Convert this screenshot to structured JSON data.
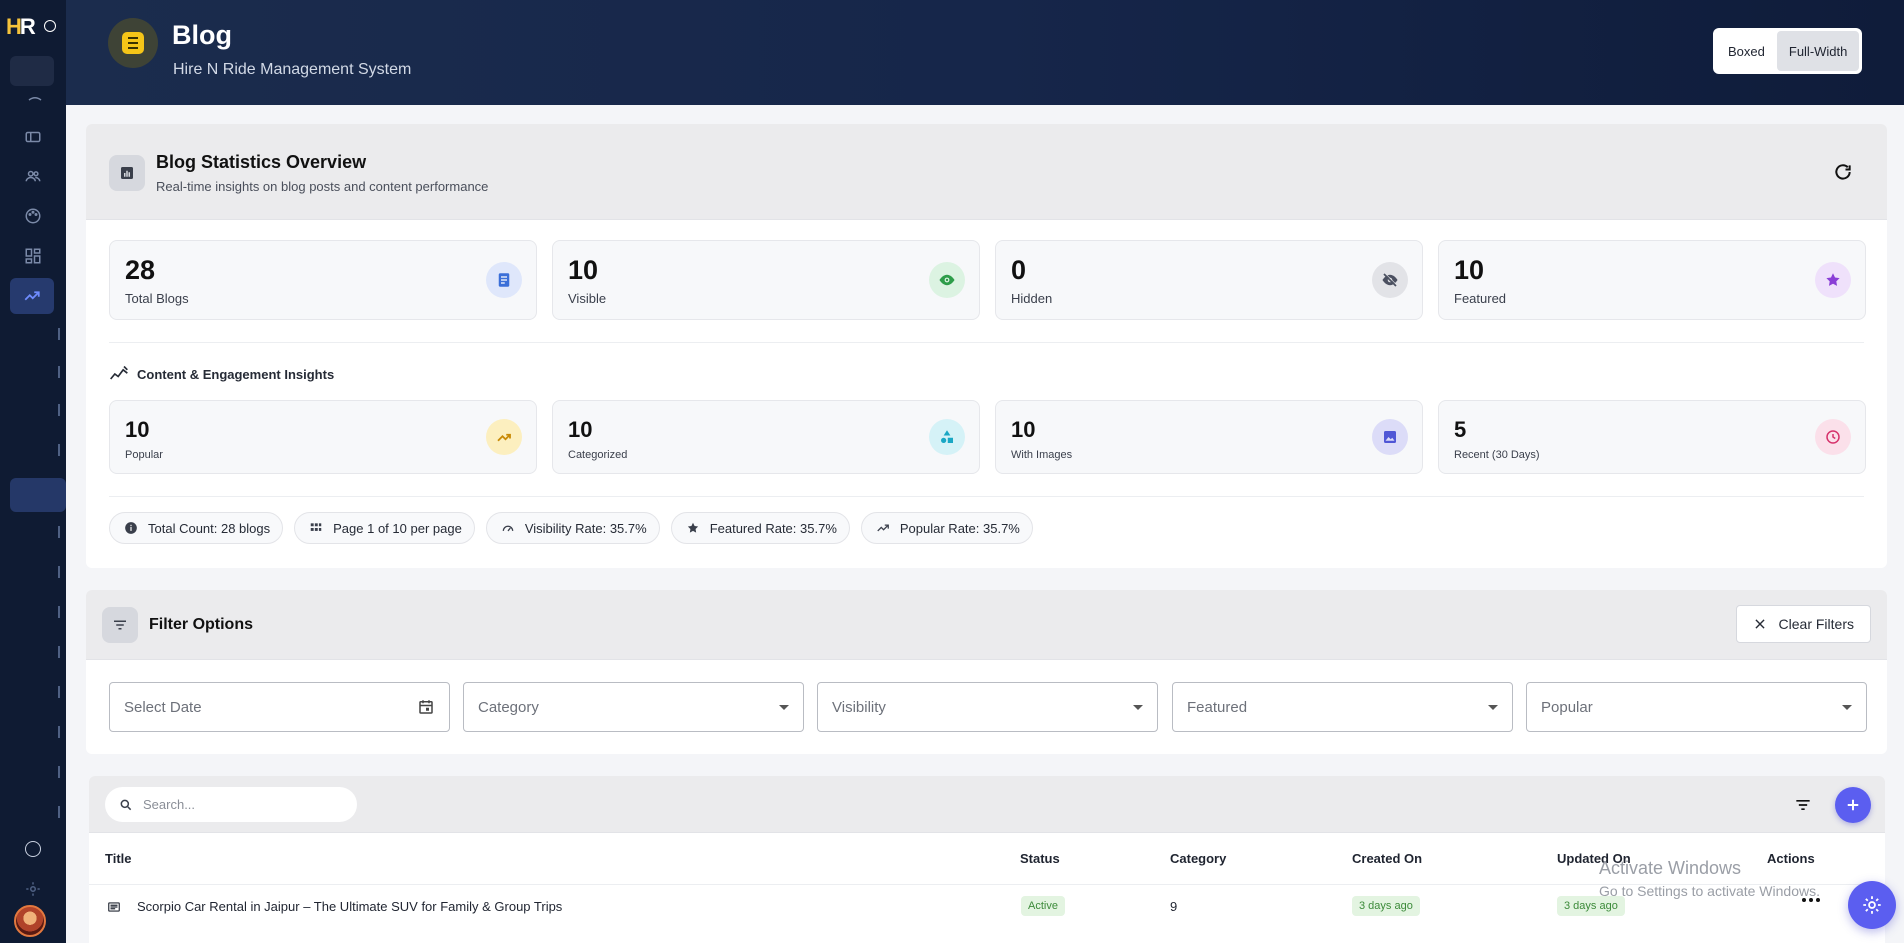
{
  "brand": {
    "logo_primary": "H",
    "logo_secondary": "R"
  },
  "header": {
    "title": "Blog",
    "subtitle": "Hire N Ride Management System",
    "layout_options": [
      "Boxed",
      "Full-Width"
    ],
    "layout_selected": "Full-Width"
  },
  "stats": {
    "title": "Blog Statistics Overview",
    "subtitle": "Real-time insights on blog posts and content performance",
    "primary": [
      {
        "value": "28",
        "label": "Total Blogs",
        "icon": "document-icon",
        "color": "#3b6fd8"
      },
      {
        "value": "10",
        "label": "Visible",
        "icon": "eye-icon",
        "color": "#2e9d4a"
      },
      {
        "value": "0",
        "label": "Hidden",
        "icon": "eye-off-icon",
        "color": "#4b5060"
      },
      {
        "value": "10",
        "label": "Featured",
        "icon": "star-icon",
        "color": "#8a3fd6"
      }
    ],
    "insights_title": "Content & Engagement Insights",
    "secondary": [
      {
        "value": "10",
        "label": "Popular",
        "icon": "trending-up-icon",
        "color": "#c98a06"
      },
      {
        "value": "10",
        "label": "Categorized",
        "icon": "shapes-icon",
        "color": "#1aa7c4"
      },
      {
        "value": "10",
        "label": "With Images",
        "icon": "image-icon",
        "color": "#4f56d6"
      },
      {
        "value": "5",
        "label": "Recent (30 Days)",
        "icon": "clock-icon",
        "color": "#d6336c"
      }
    ],
    "chips": [
      {
        "label": "Total Count: 28 blogs",
        "icon": "info-icon"
      },
      {
        "label": "Page 1 of 10 per page",
        "icon": "grid-icon"
      },
      {
        "label": "Visibility Rate: 35.7%",
        "icon": "speed-icon"
      },
      {
        "label": "Featured Rate: 35.7%",
        "icon": "star-icon"
      },
      {
        "label": "Popular Rate: 35.7%",
        "icon": "trending-up-icon"
      }
    ]
  },
  "filters": {
    "title": "Filter Options",
    "clear_label": "Clear Filters",
    "date_placeholder": "Select Date",
    "category_placeholder": "Category",
    "visibility_placeholder": "Visibility",
    "featured_placeholder": "Featured",
    "popular_placeholder": "Popular"
  },
  "table": {
    "search_placeholder": "Search...",
    "columns": [
      "Title",
      "Status",
      "Category",
      "Created On",
      "Updated On",
      "Actions"
    ],
    "rows": [
      {
        "title": "Scorpio Car Rental in Jaipur – The Ultimate SUV for Family & Group Trips",
        "status": "Active",
        "category": "9",
        "created": "3 days ago",
        "updated": "3 days ago"
      }
    ]
  },
  "watermark": {
    "line1": "Activate Windows",
    "line2": "Go to Settings to activate Windows."
  },
  "colors": {
    "sidebar": "#0f1b33",
    "accent": "#5b5ef0",
    "header_icon": "#f5c518"
  }
}
